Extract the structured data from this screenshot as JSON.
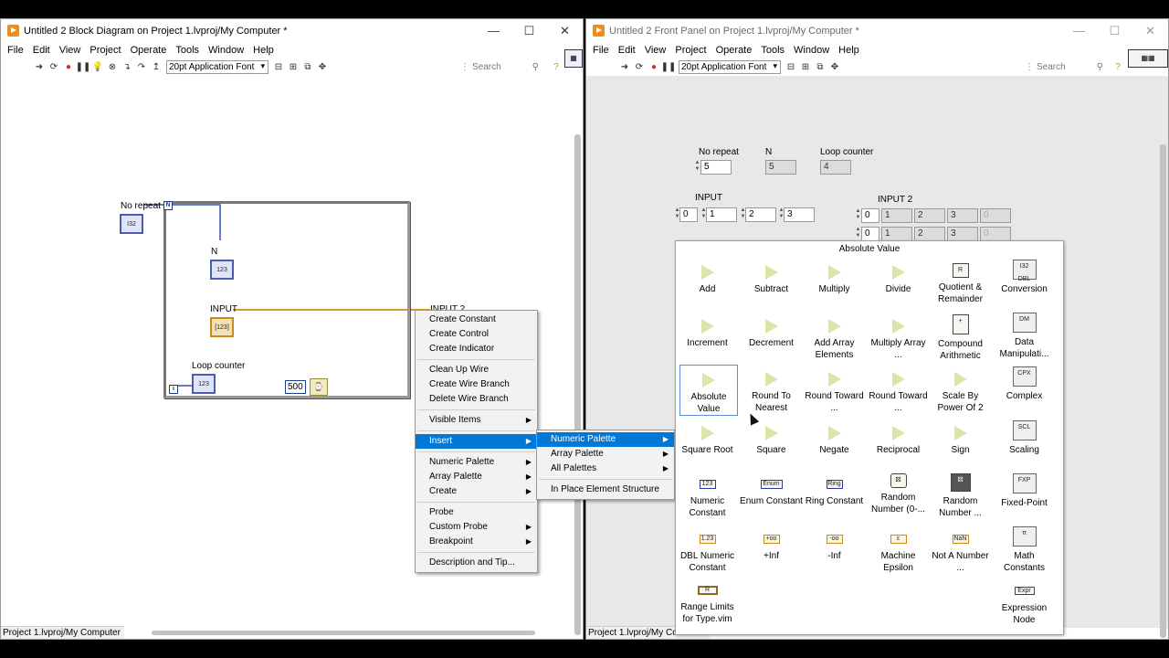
{
  "block_diagram": {
    "title": "Untitled 2 Block Diagram on Project 1.lvproj/My Computer *",
    "menu": [
      "File",
      "Edit",
      "View",
      "Project",
      "Operate",
      "Tools",
      "Window",
      "Help"
    ],
    "font": "20pt Application Font",
    "search_placeholder": "Search",
    "status": "Project 1.lvproj/My Computer",
    "labels": {
      "no_repeat": "No repeat",
      "n": "N",
      "input": "INPUT",
      "input2": "INPUT 2",
      "loop_counter": "Loop counter",
      "n_terminal": "N",
      "i_terminal": "i",
      "wait_value": "500"
    }
  },
  "front_panel": {
    "title": "Untitled 2 Front Panel on Project 1.lvproj/My Computer *",
    "menu": [
      "File",
      "Edit",
      "View",
      "Project",
      "Operate",
      "Tools",
      "Window",
      "Help"
    ],
    "font": "20pt Application Font",
    "search_placeholder": "Search",
    "status": "Project 1.lvproj/My Co",
    "controls": {
      "no_repeat_label": "No repeat",
      "no_repeat_value": "5",
      "n_label": "N",
      "n_value": "5",
      "loop_counter_label": "Loop counter",
      "loop_counter_value": "4",
      "input_label": "INPUT",
      "input_index": "0",
      "input_values": [
        "1",
        "2",
        "3"
      ],
      "input2_label": "INPUT 2",
      "input2_row1_index": "0",
      "input2_row1": [
        "1",
        "2",
        "3",
        "0"
      ],
      "input2_row2_index": "0",
      "input2_row2": [
        "1",
        "2",
        "3",
        "0"
      ]
    }
  },
  "context_menu": {
    "items": [
      {
        "label": "Create Constant"
      },
      {
        "label": "Create Control"
      },
      {
        "label": "Create Indicator"
      },
      {
        "label": "Clean Up Wire"
      },
      {
        "label": "Create Wire Branch"
      },
      {
        "label": "Delete Wire Branch"
      },
      {
        "label": "Visible Items"
      },
      {
        "label": "Insert"
      },
      {
        "label": "Numeric Palette"
      },
      {
        "label": "Array Palette"
      },
      {
        "label": "Create"
      },
      {
        "label": "Probe"
      },
      {
        "label": "Custom Probe"
      },
      {
        "label": "Breakpoint"
      },
      {
        "label": "Description and Tip..."
      }
    ]
  },
  "insert_submenu": {
    "items": [
      "Numeric Palette",
      "Array Palette",
      "All Palettes",
      "In Place Element Structure"
    ]
  },
  "palette": {
    "title": "Absolute Value",
    "items": [
      "Add",
      "Subtract",
      "Multiply",
      "Divide",
      "Quotient & Remainder",
      "Conversion",
      "Increment",
      "Decrement",
      "Add Array Elements",
      "Multiply Array ...",
      "Compound Arithmetic",
      "Data Manipulati...",
      "Absolute Value",
      "Round To Nearest",
      "Round Toward ...",
      "Round Toward ...",
      "Scale By Power Of 2",
      "Complex",
      "Square Root",
      "Square",
      "Negate",
      "Reciprocal",
      "Sign",
      "Scaling",
      "Numeric Constant",
      "Enum Constant",
      "Ring Constant",
      "Random Number (0-...",
      "Random Number ...",
      "Fixed-Point",
      "DBL Numeric Constant",
      "+Inf",
      "-Inf",
      "Machine Epsilon",
      "Not A Number ...",
      "Math Constants",
      "Range Limits for Type.vim",
      "Expression Node"
    ],
    "icon_text": {
      "conversion": "I32 DBL",
      "numeric_const": "123",
      "dbl_const": "1.23",
      "plus_inf": "+oo",
      "minus_inf": "-oo",
      "nan": "NaN",
      "enum": "Enum",
      "ring": "Ring",
      "fixed": "FXP",
      "data_manip": "DM",
      "complex": "CPX",
      "scaling": "SCL",
      "math_const": "π",
      "expr": "Expr",
      "range": "R",
      "machine_eps": "ε"
    }
  }
}
